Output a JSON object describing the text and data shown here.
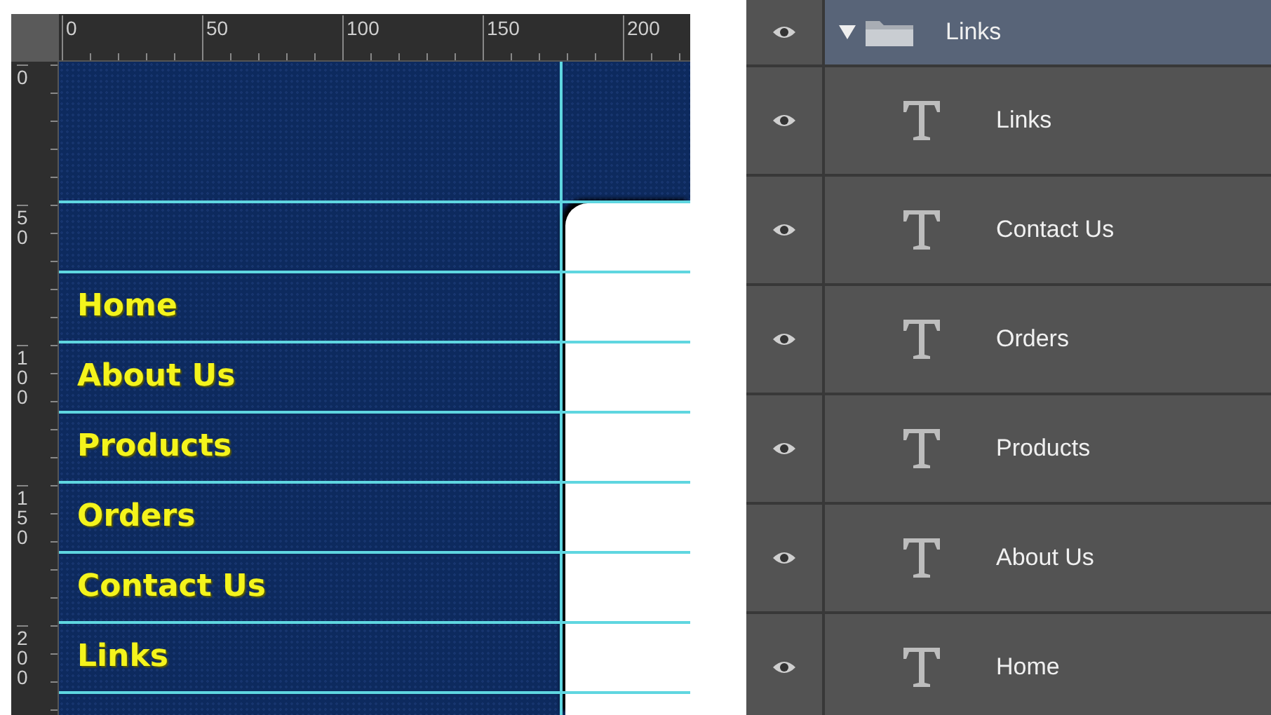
{
  "ruler": {
    "top_labels": [
      "0",
      "50",
      "100",
      "150",
      "200"
    ],
    "left_labels": [
      "0",
      "50",
      "100",
      "150",
      "200"
    ]
  },
  "canvas": {
    "nav_items": [
      "Home",
      "About Us",
      "Products",
      "Orders",
      "Contact Us",
      "Links"
    ]
  },
  "layers": {
    "group": {
      "name": "Links",
      "expanded": true,
      "selected": true,
      "visible": true
    },
    "children": [
      {
        "name": "Links",
        "kind": "text",
        "visible": true,
        "selected": false
      },
      {
        "name": "Contact Us",
        "kind": "text",
        "visible": true,
        "selected": false
      },
      {
        "name": "Orders",
        "kind": "text",
        "visible": true,
        "selected": false
      },
      {
        "name": "Products",
        "kind": "text",
        "visible": true,
        "selected": false
      },
      {
        "name": "About Us",
        "kind": "text",
        "visible": true,
        "selected": false
      },
      {
        "name": "Home",
        "kind": "text",
        "visible": true,
        "selected": false
      }
    ]
  }
}
